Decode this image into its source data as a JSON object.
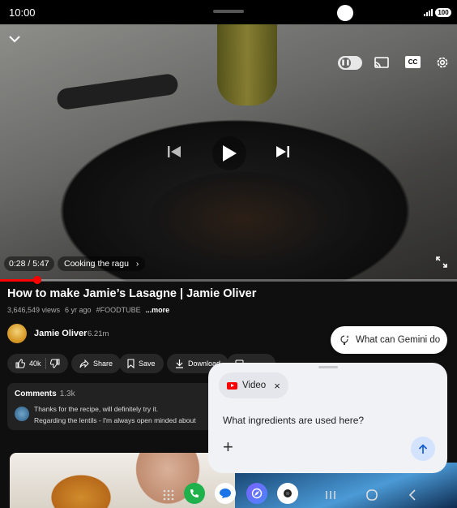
{
  "status_bar": {
    "time": "10:00",
    "battery": "100"
  },
  "player": {
    "time_label": "0:28 / 5:47",
    "chapter": "Cooking the ragu",
    "chapter_arrow": "›",
    "progress_fraction": 0.0815,
    "controls": [
      "collapse-icon",
      "pause-toggle",
      "cast-icon",
      "cc-icon",
      "gear-icon",
      "previous-icon",
      "play-icon",
      "next-icon",
      "fullscreen-icon"
    ],
    "cc_label": "CC"
  },
  "video": {
    "title": "How to make Jamie’s Lasagne | Jamie Oliver",
    "views": "3,646,549 views",
    "age": "6 yr ago",
    "hashtag": "#FOODTUBE",
    "more": "...more"
  },
  "channel": {
    "name": "Jamie Oliver",
    "subscribers": "6.21m"
  },
  "actions": {
    "likes": "40k",
    "share": "Share",
    "save": "Save",
    "download": "Download"
  },
  "comments": {
    "header": "Comments",
    "count": "1.3k",
    "line1": "Thanks for the recipe, will definitely try it.",
    "line2": "Regarding the lentils - I'm always open minded about"
  },
  "gemini": {
    "pill_text": "What can Gemini do",
    "chip_label": "Video",
    "chip_close": "×",
    "prompt": "What ingredients are used here?",
    "plus": "+"
  },
  "taskbar": {
    "apps": [
      "apps-grid-icon",
      "phone-icon",
      "messages-icon",
      "browser-icon",
      "camera-icon",
      "recents-icon",
      "home-icon",
      "back-icon"
    ]
  },
  "colors": {
    "accent_red": "#ff0000",
    "gemini_send": "#d3e3fd",
    "background": "#0f0f0f"
  }
}
